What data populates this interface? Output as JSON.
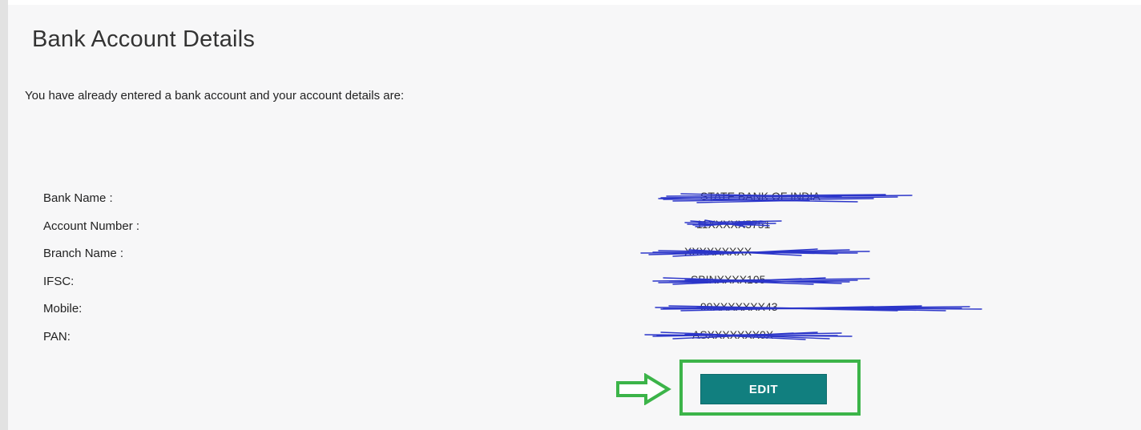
{
  "page": {
    "title": "Bank Account Details",
    "intro": "You have already entered a bank account and your account details are:"
  },
  "details": [
    {
      "label": "Bank Name :",
      "value": "STATE BANK OF INDIA"
    },
    {
      "label": "Account Number :",
      "value": "11XXXXX5751"
    },
    {
      "label": "Branch Name :",
      "value": "XXXXXXXXX"
    },
    {
      "label": "IFSC:",
      "value": "SBINXXXX105"
    },
    {
      "label": "Mobile:",
      "value": "99XXXXXXX43"
    },
    {
      "label": "PAN:",
      "value": "ASXXXXXXX0X"
    }
  ],
  "actions": {
    "edit_label": "EDIT"
  },
  "colors": {
    "button": "#117f7f",
    "highlight": "#3cb449",
    "redaction": "#2b35c9"
  },
  "icons": {
    "pointer": "right-arrow-icon"
  }
}
